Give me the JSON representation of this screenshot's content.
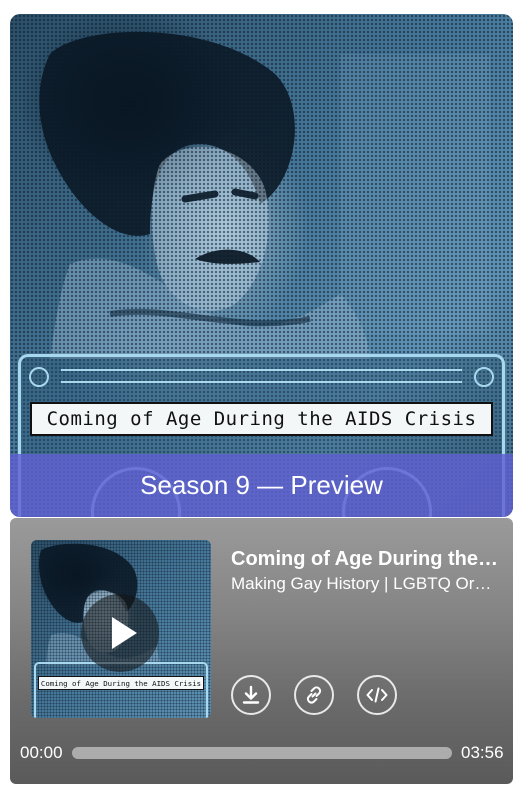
{
  "cover": {
    "tape_label": "Coming of Age During the AIDS Crisis",
    "banner": "Season 9 — Preview"
  },
  "player": {
    "thumbnail_label": "Coming of Age During the AIDS Crisis",
    "episode_title": "Coming of Age During the AIDS Crisis",
    "show_name": "Making Gay History | LGBTQ Oral Histories",
    "current_time": "00:00",
    "duration": "03:56",
    "progress": 0,
    "icons": {
      "play": "play-icon",
      "download": "download-icon",
      "link": "link-icon",
      "embed": "embed-code-icon"
    }
  },
  "colors": {
    "banner": "#6060d2",
    "duotone": "#46789a",
    "player_bg": "#858585"
  }
}
